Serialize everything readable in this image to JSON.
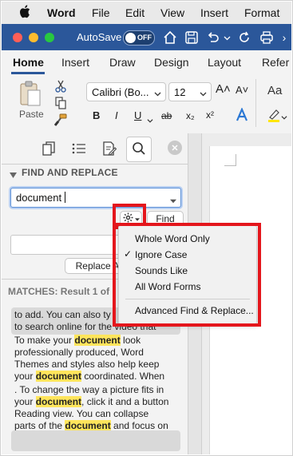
{
  "menubar": {
    "apple": "",
    "app": "Word",
    "items": [
      "File",
      "Edit",
      "View",
      "Insert",
      "Format"
    ]
  },
  "titlebar": {
    "autosave_label": "AutoSave",
    "toggle_state": "OFF"
  },
  "ribbon_tabs": [
    "Home",
    "Insert",
    "Draw",
    "Design",
    "Layout",
    "Refer"
  ],
  "ribbon": {
    "paste_label": "Paste",
    "font_name": "Calibri (Bo...",
    "font_size": "12",
    "grow_font": "A˄",
    "shrink_font": "A˅",
    "styles_glyph": "Aa",
    "format_buttons": [
      "B",
      "I",
      "U",
      "ab",
      "x₂",
      "x²"
    ]
  },
  "pane": {
    "section_title": "FIND AND REPLACE",
    "search_value": "document",
    "find_label": "Find",
    "replace_label": "Replace A",
    "matches_label": "MATCHES: Result 1 of"
  },
  "snippets": [
    [
      "to add. You can also ty",
      "to search online for the video that"
    ],
    [
      "To make your ",
      "document",
      " look",
      "professionally produced, Word",
      "Themes and styles also help keep",
      "your ",
      "document",
      " coordinated. When"
    ],
    [
      ". To change the way a picture fits in",
      "your ",
      "document",
      ", click it and a button",
      "Reading view. You can collapse",
      "parts of the ",
      "document",
      " and focus on"
    ]
  ],
  "popup": {
    "items": [
      "Whole Word Only",
      "Ignore Case",
      "Sounds Like",
      "All Word Forms"
    ],
    "checked": "✓",
    "advanced": "Advanced Find & Replace..."
  },
  "colors": {
    "titlebar": "#2b579a",
    "highlight": "#ffe55c",
    "annotation_red": "#e4161c"
  }
}
